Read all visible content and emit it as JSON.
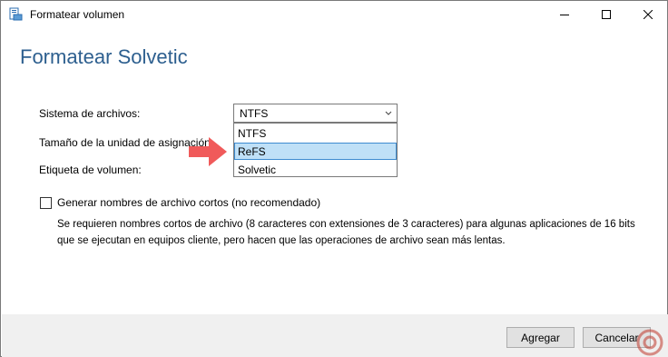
{
  "window": {
    "title": "Formatear volumen",
    "icon": "format-volume-icon"
  },
  "heading": "Formatear Solvetic",
  "form": {
    "file_system_label": "Sistema de archivos:",
    "allocation_label": "Tamaño de la unidad de asignación:",
    "volume_label_label": "Etiqueta de volumen:",
    "file_system_selected": "NTFS",
    "file_system_options": [
      "NTFS",
      "ReFS"
    ],
    "highlighted_option": "ReFS",
    "volume_label_value": "Solvetic"
  },
  "short_names": {
    "checked": false,
    "label": "Generar nombres de archivo cortos (no recomendado)",
    "description_line1": "Se requieren nombres cortos de archivo (8 caracteres con extensiones de 3 caracteres) para algunas aplicaciones de 16 bits",
    "description_line2": "que se ejecutan en equipos cliente, pero hacen que las operaciones de archivo sean más lentas."
  },
  "buttons": {
    "add": "Agregar",
    "cancel": "Cancelar"
  },
  "colors": {
    "heading": "#2d5f8f",
    "highlight_bg": "#bfe0f7",
    "highlight_border": "#3e8bd0",
    "arrow": "#f05a5a"
  }
}
